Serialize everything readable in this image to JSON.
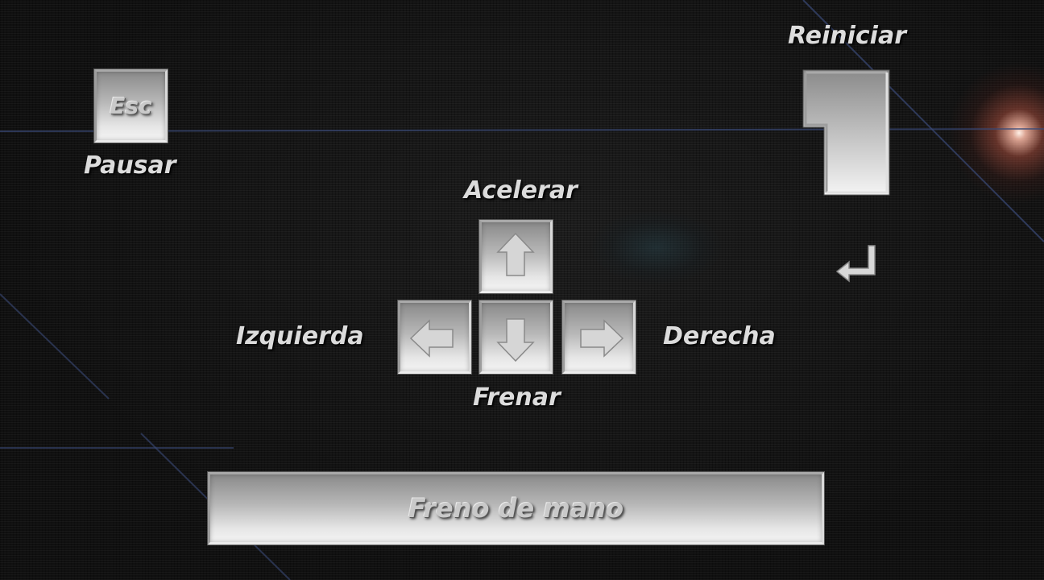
{
  "controls": {
    "pause_label": "Pausar",
    "restart_label": "Reiniciar",
    "accelerate_label": "Acelerar",
    "brake_label": "Frenar",
    "left_label": "Izquierda",
    "right_label": "Derecha"
  },
  "keys": {
    "esc": "Esc",
    "handbrake": "Freno de mano"
  },
  "icons": {
    "enter": "enter-icon",
    "up": "arrow-up-icon",
    "down": "arrow-down-icon",
    "left": "arrow-left-icon",
    "right": "arrow-right-icon"
  },
  "colors": {
    "background": "#111111",
    "label_text": "#dcdcdc",
    "key_face": "#d4d4d4",
    "flare": "#ffbcaa"
  }
}
